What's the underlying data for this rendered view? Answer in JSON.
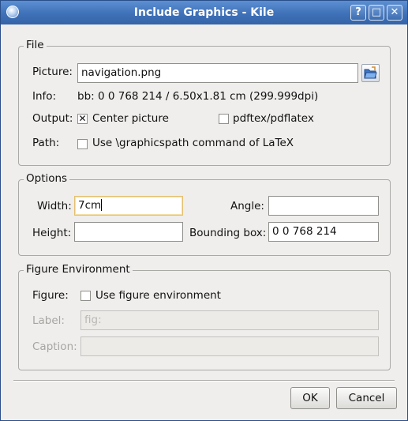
{
  "window": {
    "title": "Include Graphics - Kile",
    "help_glyph": "?",
    "maximize_glyph": "□",
    "close_glyph": "✕"
  },
  "file": {
    "group_label": "File",
    "picture_label": "Picture:",
    "picture_value": "navigation.png",
    "info_label": "Info:",
    "info_value": "bb: 0 0 768 214 / 6.50x1.81 cm  (299.999dpi)",
    "output_label": "Output:",
    "center_picture_label": "Center picture",
    "center_picture_checked": true,
    "pdftex_label": "pdftex/pdflatex",
    "pdftex_checked": false,
    "path_label": "Path:",
    "graphicspath_label": "Use \\graphicspath command of LaTeX",
    "graphicspath_checked": false,
    "check_glyph": "✕"
  },
  "options": {
    "group_label": "Options",
    "width_label": "Width:",
    "width_value": "7cm",
    "angle_label": "Angle:",
    "angle_value": "",
    "height_label": "Height:",
    "height_value": "",
    "bbox_label": "Bounding box:",
    "bbox_value": "0 0 768 214"
  },
  "figure": {
    "group_label": "Figure Environment",
    "figure_label": "Figure:",
    "use_figure_label": "Use figure environment",
    "use_figure_checked": false,
    "label_label": "Label:",
    "label_value": "fig:",
    "caption_label": "Caption:",
    "caption_value": ""
  },
  "buttons": {
    "ok_label": "OK",
    "cancel_label": "Cancel"
  },
  "colors": {
    "titlebar": "#3f71b8",
    "dialog_bg": "#efeeec",
    "focus_border": "#e3c073"
  },
  "icons": [
    "kile-app-icon",
    "folder-open-icon"
  ]
}
